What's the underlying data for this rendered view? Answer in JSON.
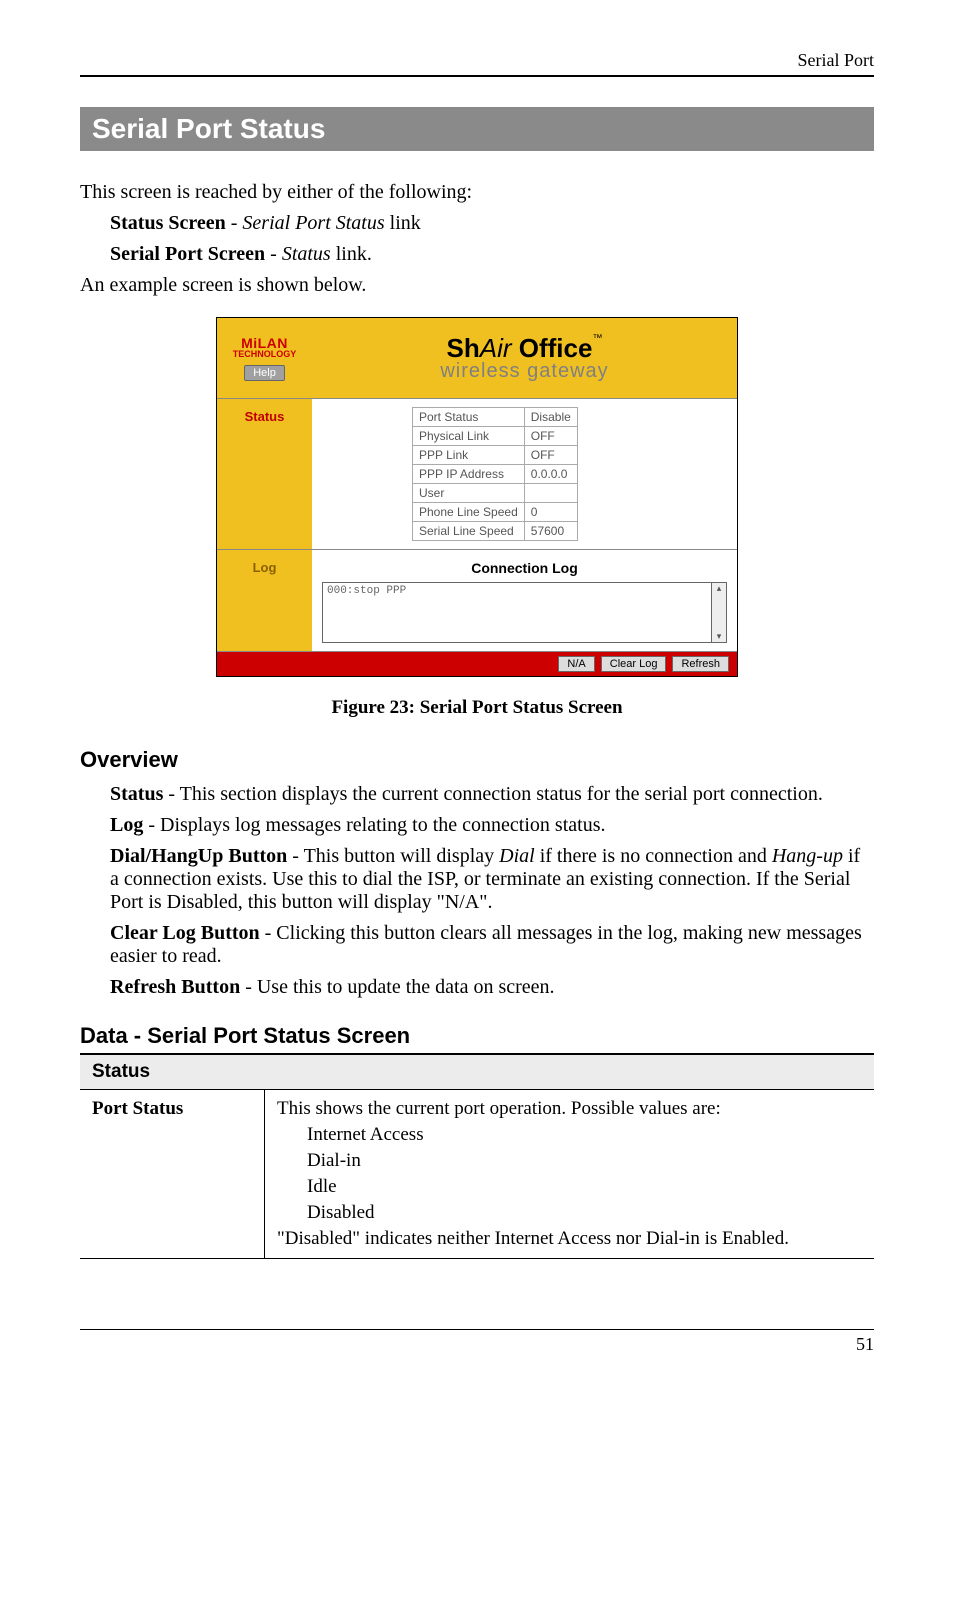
{
  "header": {
    "breadcrumb": "Serial Port"
  },
  "section_bar": "Serial Port Status",
  "intro": "This screen is reached by either of the following:",
  "intro_bullets": [
    {
      "bold": "Status Screen",
      "sep": " - ",
      "ital": "Serial Port Status",
      "tail": " link"
    },
    {
      "bold": "Serial Port Screen",
      "sep": " - ",
      "ital": "Status",
      "tail": " link."
    }
  ],
  "intro_after": "An example screen is shown below.",
  "figure": {
    "logo": "MiLAN",
    "logo_sub": "TECHNOLOGY",
    "help": "Help",
    "title_sh": "Sh",
    "title_air": "Air",
    "title_office": " Office",
    "title_tm": "™",
    "subtitle": "wireless gateway",
    "status_label": "Status",
    "status_rows": [
      [
        "Port Status",
        "Disable"
      ],
      [
        "Physical Link",
        "OFF"
      ],
      [
        "PPP Link",
        "OFF"
      ],
      [
        "PPP IP Address",
        "0.0.0.0"
      ],
      [
        "User",
        ""
      ],
      [
        "Phone Line Speed",
        "0"
      ],
      [
        "Serial Line Speed",
        "57600"
      ]
    ],
    "log_label": "Log",
    "conn_heading": "Connection Log",
    "log_text": "000:stop PPP",
    "btn_na": "N/A",
    "btn_clear": "Clear Log",
    "btn_refresh": "Refresh"
  },
  "figure_caption": "Figure 23: Serial Port Status Screen",
  "overview_heading": "Overview",
  "overview_items": [
    {
      "bold": "Status",
      "text": " - This section displays the current connection status for the serial port connection."
    },
    {
      "bold": "Log",
      "text": " - Displays log messages relating to the connection status."
    },
    {
      "bold": "Dial/HangUp Button",
      "text_prefix": " - This button will display ",
      "ital1": "Dial",
      "mid": " if there is no connection and ",
      "ital2": "Hang-up",
      "tail": " if a connection exists. Use this to dial the ISP, or terminate an existing connection. If the Serial Port is Disabled, this button will display \"N/A\"."
    },
    {
      "bold": "Clear Log Button",
      "text": " - Clicking this button clears all messages in the log, making new messages easier to read."
    },
    {
      "bold": "Refresh Button",
      "text": " - Use this to update the data on screen."
    }
  ],
  "data_heading": "Data - Serial Port Status Screen",
  "data_table": {
    "group_header": "Status",
    "row1_label": "Port Status",
    "row1_intro": "This shows the current port operation. Possible values are:",
    "row1_values": [
      "Internet Access",
      "Dial-in",
      "Idle",
      "Disabled"
    ],
    "row1_tail": "\"Disabled\" indicates neither Internet Access nor Dial-in is Enabled."
  },
  "page_number": "51"
}
